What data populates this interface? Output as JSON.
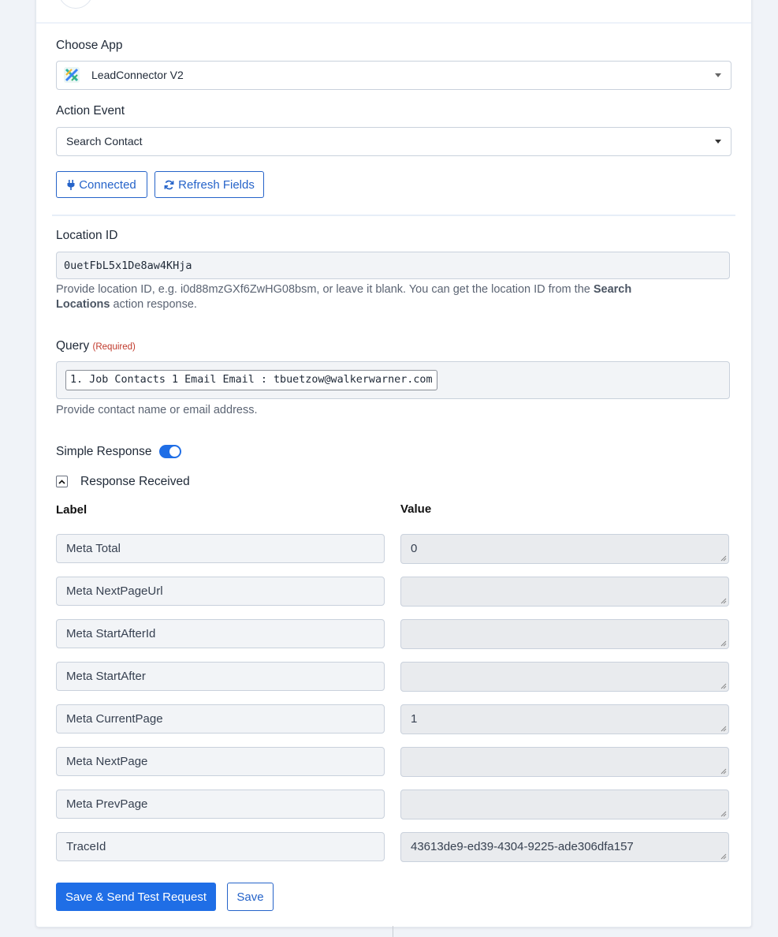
{
  "choose_app": {
    "label": "Choose App",
    "selected": "LeadConnector V2",
    "logo_icon": "leadconnector-logo-icon"
  },
  "action_event": {
    "label": "Action Event",
    "selected": "Search Contact"
  },
  "buttons": {
    "connected": "Connected",
    "connected_icon": "plug-icon",
    "refresh": "Refresh Fields",
    "refresh_icon": "refresh-icon"
  },
  "location_id": {
    "label": "Location ID",
    "value": "0uetFbL5x1De8aw4KHja",
    "help_prefix": "Provide location ID, e.g. i0d88mzGXf6ZwHG08bsm, or leave it blank. You can get the location ID from the ",
    "help_bold": "Search Locations",
    "help_suffix": " action response."
  },
  "query": {
    "label": "Query",
    "required": "(Required)",
    "value": "1. Job Contacts 1 Email Email : tbuetzow@walkerwarner.com",
    "help": "Provide contact name or email address."
  },
  "simple_response": {
    "label": "Simple Response",
    "enabled": true
  },
  "response": {
    "title": "Response Received",
    "label_header": "Label",
    "value_header": "Value",
    "rows": [
      {
        "label": "Meta Total",
        "value": "0"
      },
      {
        "label": "Meta NextPageUrl",
        "value": ""
      },
      {
        "label": "Meta StartAfterId",
        "value": ""
      },
      {
        "label": "Meta StartAfter",
        "value": ""
      },
      {
        "label": "Meta CurrentPage",
        "value": "1"
      },
      {
        "label": "Meta NextPage",
        "value": ""
      },
      {
        "label": "Meta PrevPage",
        "value": ""
      },
      {
        "label": "TraceId",
        "value": "43613de9-ed39-4304-9225-ade306dfa157"
      }
    ]
  },
  "actions": {
    "save_send": "Save & Send Test Request",
    "save": "Save"
  },
  "colors": {
    "primary": "#1f6ee6",
    "required": "#c0392b",
    "background": "#f0f3f8"
  }
}
